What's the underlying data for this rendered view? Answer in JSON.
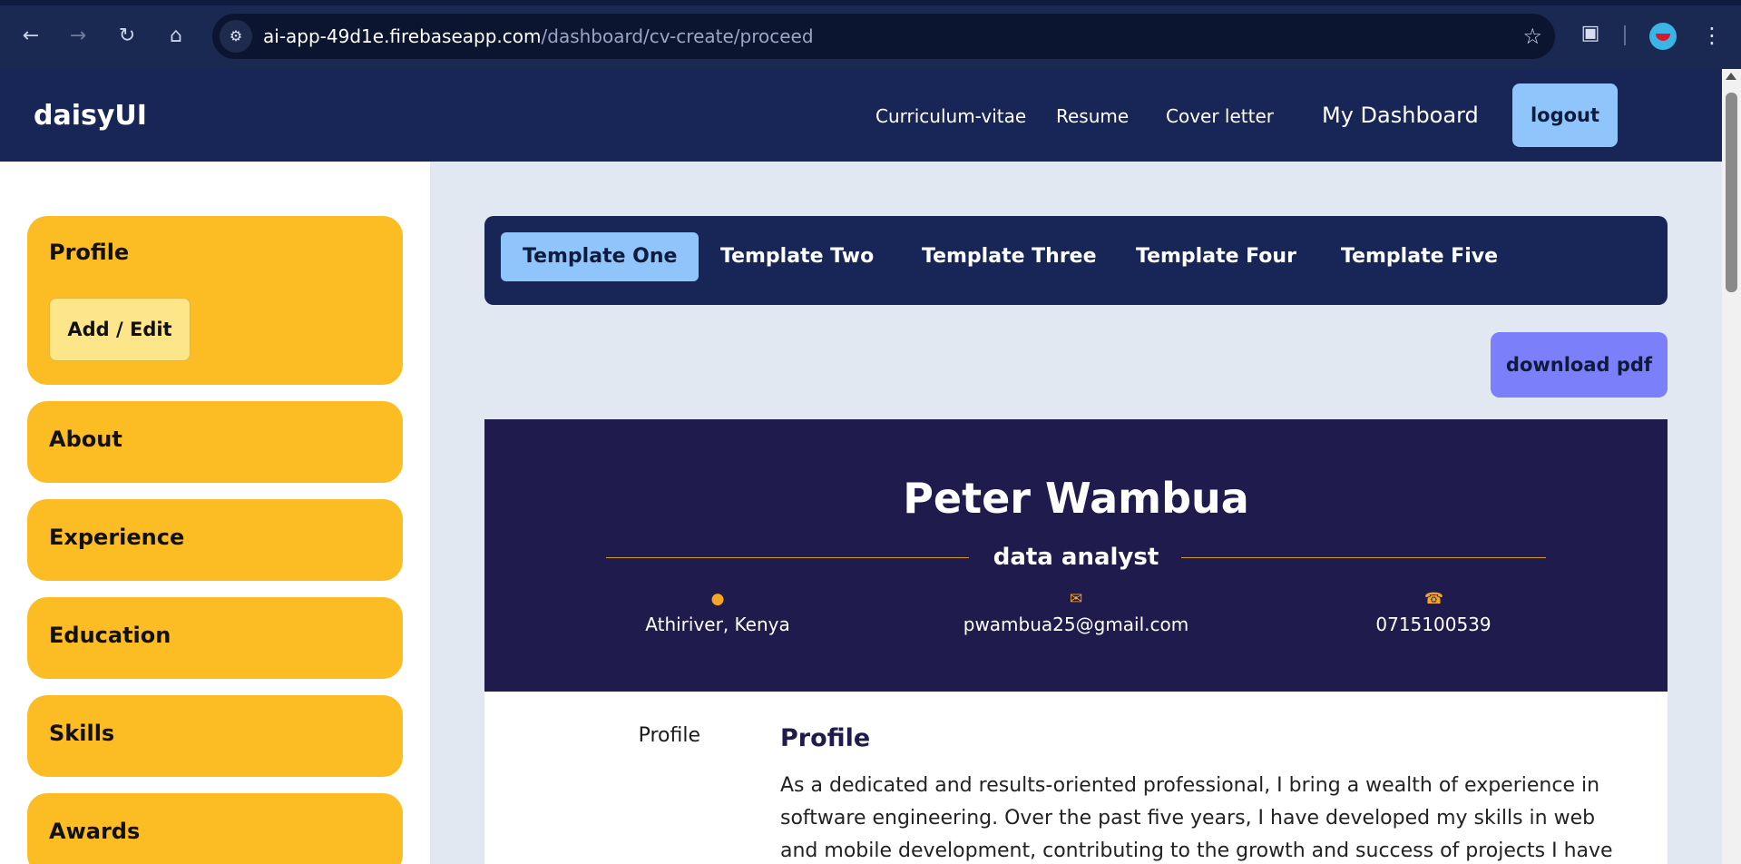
{
  "browser": {
    "url_host": "ai-app-49d1e.firebaseapp.com",
    "url_path": "/dashboard/cv-create/proceed",
    "icons": [
      "back-icon",
      "forward-icon",
      "reload-icon",
      "home-icon",
      "site-info-icon",
      "bookmark-star-icon",
      "extensions-icon",
      "profile-avatar",
      "menu-dots-icon"
    ]
  },
  "navbar": {
    "brand": "daisyUI",
    "links": [
      "Curriculum-vitae",
      "Resume",
      "Cover letter"
    ],
    "dashboard": "My Dashboard",
    "logout": "logout"
  },
  "sidebar": {
    "profile": {
      "title": "Profile",
      "action": "Add / Edit"
    },
    "sections": [
      "About",
      "Experience",
      "Education",
      "Skills",
      "Awards"
    ]
  },
  "templates": {
    "tabs": [
      "Template One",
      "Template Two",
      "Template Three",
      "Template Four",
      "Template Five"
    ],
    "active_index": 0
  },
  "download_label": "download pdf",
  "cv": {
    "name": "Peter Wambua",
    "role": "data analyst",
    "location": "Athiriver, Kenya",
    "email": "pwambua25@gmail.com",
    "phone": "0715100539",
    "side_label": "Profile",
    "section_title": "Profile",
    "paragraph": "As a dedicated and results-oriented professional, I bring a wealth of experience in software engineering. Over the past five years, I have developed my skills in web and mobile development, contributing to the growth and success of projects I have"
  },
  "colors": {
    "navy": "#182657",
    "accent_yellow": "#fbbd23",
    "light_blue": "#90c5fb",
    "cv_header": "#201b4d",
    "download": "#7b7ff9"
  }
}
